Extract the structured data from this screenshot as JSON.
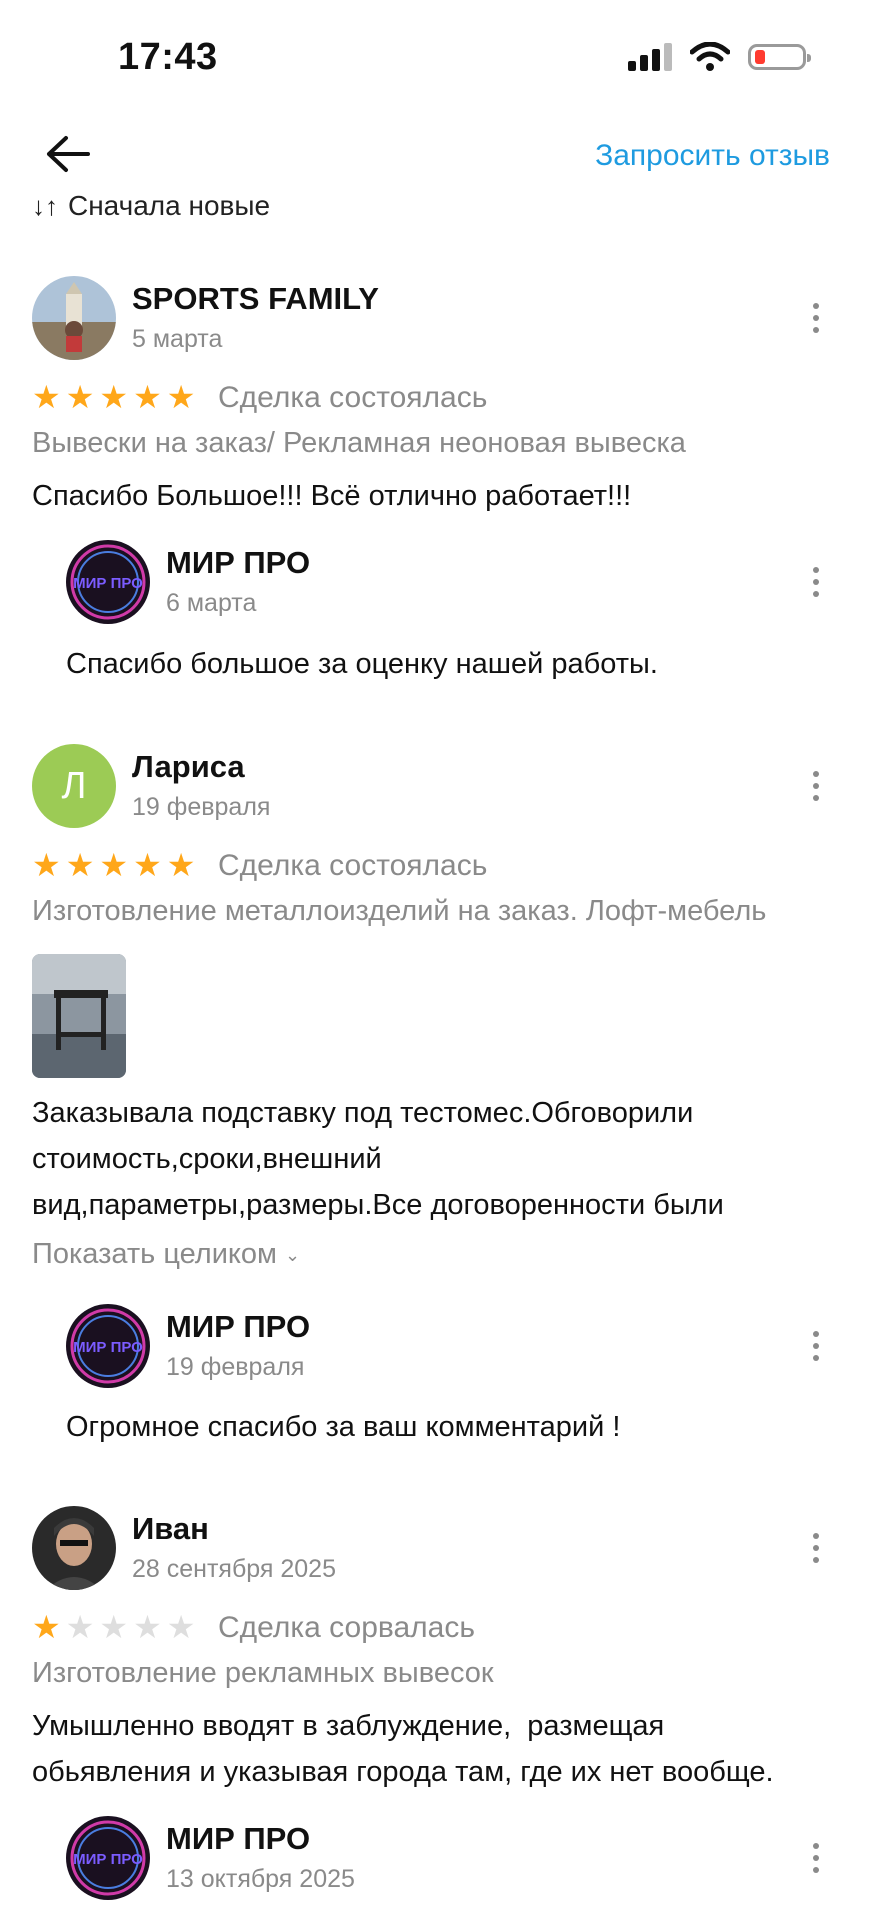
{
  "status_bar": {
    "time": "17:43"
  },
  "nav": {
    "request_review": "Запросить отзыв",
    "sort_label": "Сначала новые",
    "sort_icon": "↓↑"
  },
  "reviews": [
    {
      "author": "SPORTS FAMILY",
      "date": "5 марта",
      "rating": 5,
      "deal_status": "Сделка состоялась",
      "service": "Вывески на заказ/ Рекламная неоновая вывеска",
      "text": "Спасибо Большое!!! Всё отлично работает!!!",
      "reply": {
        "author": "МИР ПРО",
        "logo_text": "МИР ПРО",
        "date": "6 марта",
        "text": "Спасибо большое за оценку нашей работы."
      }
    },
    {
      "author": "Лариса",
      "avatar_letter": "Л",
      "date": "19 февраля",
      "rating": 5,
      "deal_status": "Сделка состоялась",
      "service": "Изготовление металлоизделий на заказ. Лофт-мебель",
      "text_lines": [
        "Заказывала подставку под тестомес.Обговорили",
        "стоимость,сроки,внешний",
        "вид,параметры,размеры.Все договоренности были"
      ],
      "show_all": "Показать целиком",
      "reply": {
        "author": "МИР ПРО",
        "logo_text": "МИР ПРО",
        "date": "19 февраля",
        "text": "Огромное спасибо за ваш комментарий !"
      }
    },
    {
      "author": "Иван",
      "date": "28 сентября 2025",
      "rating": 1,
      "deal_status": "Сделка сорвалась",
      "service": "Изготовление рекламных вывесок",
      "text_lines": [
        "Умышленно вводят в заблуждение,  размещая",
        "обьявления и указывая города там, где их нет вообще."
      ],
      "reply": {
        "author": "МИР ПРО",
        "logo_text": "МИР ПРО",
        "date": "13 октября 2025"
      }
    }
  ],
  "colors": {
    "accent": "#1e9be0",
    "star": "#ffa71a",
    "star_off": "#dedede",
    "muted": "#8a8a8a",
    "avatar_green": "#9ccb55"
  }
}
